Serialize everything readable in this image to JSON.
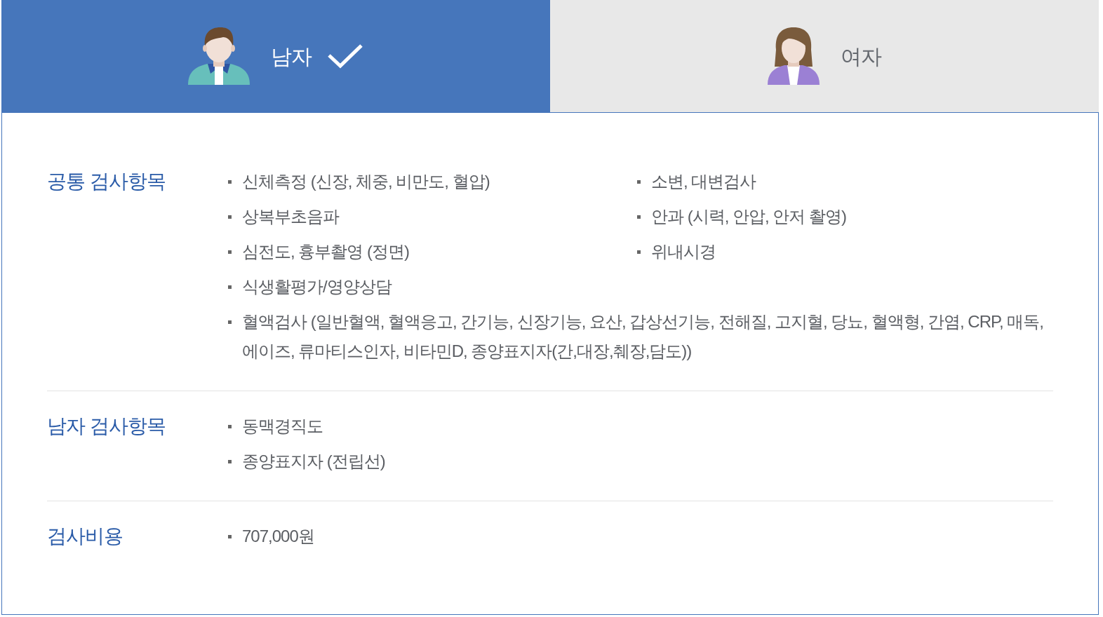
{
  "tabs": [
    {
      "kind": "male",
      "label": "남자",
      "selected": true
    },
    {
      "kind": "female",
      "label": "여자",
      "selected": false
    }
  ],
  "sections": [
    {
      "title": "공통 검사항목",
      "items": [
        {
          "kind": "item",
          "text": "신체측정 (신장, 체중, 비만도, 혈압)"
        },
        {
          "kind": "item",
          "text": "소변, 대변검사"
        },
        {
          "kind": "item",
          "text": "상복부초음파"
        },
        {
          "kind": "item",
          "text": "안과 (시력, 안압, 안저 촬영)"
        },
        {
          "kind": "item",
          "text": "심전도, 흉부촬영 (정면)"
        },
        {
          "kind": "item",
          "text": "위내시경"
        },
        {
          "kind": "item",
          "text": "식생활평가/영양상담"
        },
        {
          "kind": "wide",
          "text": "혈액검사 (일반혈액, 혈액응고, 간기능, 신장기능, 요산, 갑상선기능, 전해질, 고지혈, 당뇨, 혈액형, 간염, CRP, 매독, 에이즈, 류마티스인자, 비타민D, 종양표지자(간,대장,췌장,담도))"
        }
      ]
    },
    {
      "title": "남자 검사항목",
      "items": [
        {
          "kind": "wide",
          "text": "동맥경직도"
        },
        {
          "kind": "wide",
          "text": "종양표지자 (전립선)"
        }
      ]
    },
    {
      "title": "검사비용",
      "items": [
        {
          "kind": "wide",
          "text": "707,000원"
        }
      ]
    }
  ]
}
